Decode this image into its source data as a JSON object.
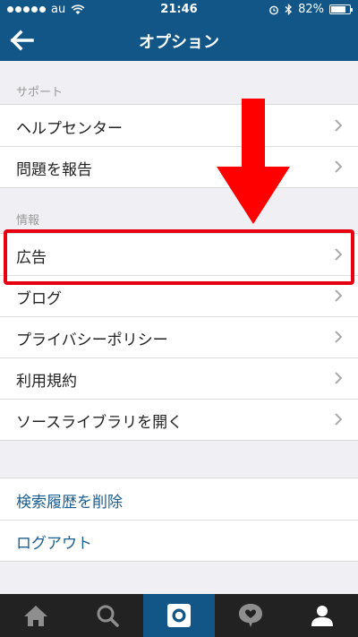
{
  "status_bar": {
    "carrier": "au",
    "time": "21:46",
    "battery": "82%",
    "battery_level": 0.82
  },
  "header": {
    "title": "オプション",
    "back_icon": "back-arrow-icon"
  },
  "sections": [
    {
      "title": "サポート",
      "items": [
        {
          "label": "ヘルプセンター"
        },
        {
          "label": "問題を報告"
        }
      ]
    },
    {
      "title": "情報",
      "items": [
        {
          "label": "広告"
        },
        {
          "label": "ブログ"
        },
        {
          "label": "プライバシーポリシー"
        },
        {
          "label": "利用規約"
        },
        {
          "label": "ソースライブラリを開く"
        }
      ]
    },
    {
      "items": [
        {
          "label": "検索履歴を削除"
        },
        {
          "label": "ログアウト"
        }
      ]
    }
  ],
  "annotation": {
    "highlight_color": "#e60012",
    "arrow_color": "#ff0000"
  },
  "tab_bar": {
    "tabs": [
      "home-icon",
      "search-icon",
      "camera-icon",
      "activity-heart-icon",
      "profile-icon"
    ],
    "active_tab": "camera-icon"
  },
  "colors": {
    "nav": "#125688",
    "link": "#1a5d8f",
    "tab_bar": "#222222"
  }
}
